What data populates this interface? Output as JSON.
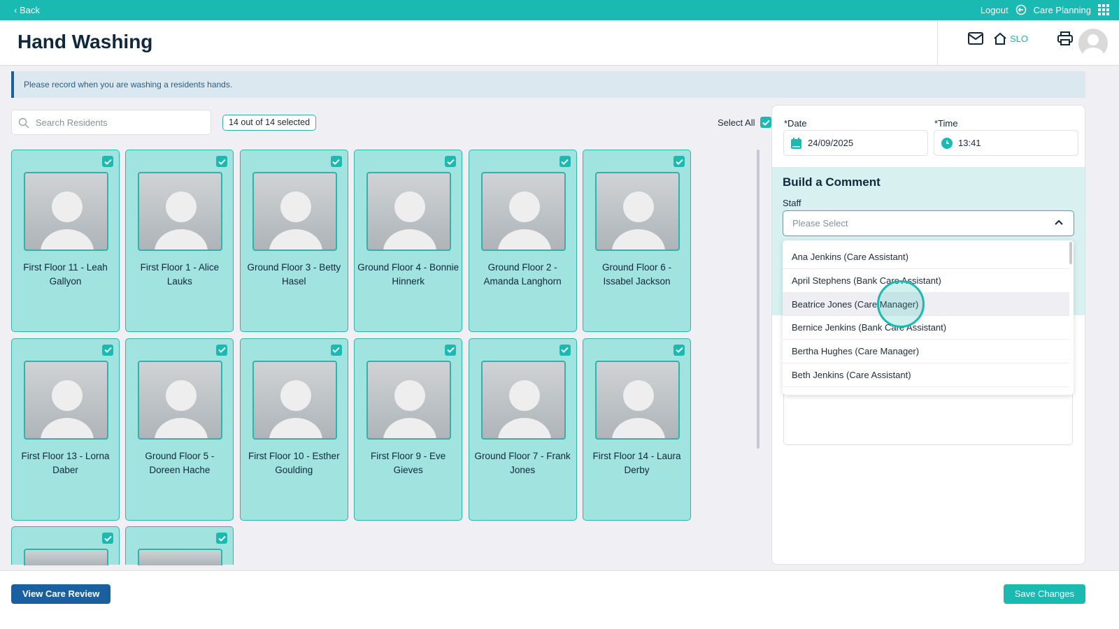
{
  "topbar": {
    "back": "‹ Back",
    "logout": "Logout",
    "app": "Care Planning"
  },
  "header": {
    "title": "Hand Washing",
    "location": "SLO"
  },
  "banner": "Please record when you are washing a residents hands.",
  "search": {
    "placeholder": "Search Residents"
  },
  "selection": {
    "badge": "14 out of 14 selected",
    "select_all": "Select All"
  },
  "residents": [
    {
      "name": "First Floor 11 - Leah Gallyon",
      "checked": true
    },
    {
      "name": "First Floor 1 - Alice Lauks",
      "checked": true
    },
    {
      "name": "Ground Floor 3 - Betty Hasel",
      "checked": true
    },
    {
      "name": "Ground Floor 4 - Bonnie Hinnerk",
      "checked": true
    },
    {
      "name": "Ground Floor 2 - Amanda Langhorn",
      "checked": true
    },
    {
      "name": "Ground Floor 6 - Issabel Jackson",
      "checked": true
    },
    {
      "name": "First Floor 13 - Lorna Daber",
      "checked": true
    },
    {
      "name": "Ground Floor 5 - Doreen Hache",
      "checked": true
    },
    {
      "name": "First Floor 10 - Esther Goulding",
      "checked": true
    },
    {
      "name": "First Floor 9 - Eve Gieves",
      "checked": true
    },
    {
      "name": "Ground Floor 7 - Frank Jones",
      "checked": true
    },
    {
      "name": "First Floor 14 - Laura Derby",
      "checked": true
    },
    {
      "name": "",
      "checked": true
    },
    {
      "name": "",
      "checked": true
    }
  ],
  "form": {
    "date_label": "*Date",
    "date": "24/09/2025",
    "time_label": "*Time",
    "time": "13:41",
    "comment_title": "Build a Comment",
    "staff_label": "Staff",
    "staff_placeholder": "Please Select"
  },
  "staff_options": [
    "Ana Jenkins (Care Assistant)",
    "April Stephens (Bank Care Assistant)",
    "Beatrice Jones (Care Manager)",
    "Bernice Jenkins (Bank Care Assistant)",
    "Bertha Hughes (Care Manager)",
    "Beth Jenkins (Care Assistant)"
  ],
  "footer": {
    "view_review": "View Care Review",
    "save": "Save Changes"
  },
  "colors": {
    "teal": "#1ab9b1",
    "card": "#a0e3df",
    "blue": "#1a5fa0"
  }
}
